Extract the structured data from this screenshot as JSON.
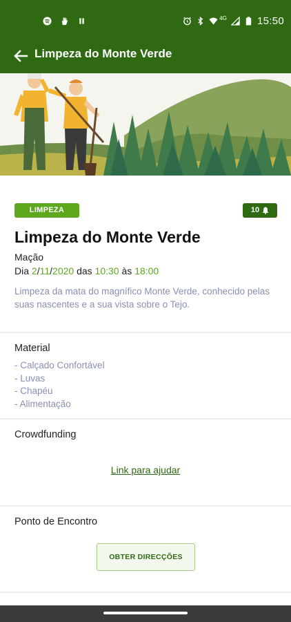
{
  "status_bar": {
    "time": "15:50",
    "network": "4G",
    "left_icons": [
      "spotify-icon",
      "hand-icon",
      "pause-icon"
    ],
    "right_icons": [
      "alarm-icon",
      "bluetooth-icon",
      "wifi-icon",
      "signal-icon",
      "battery-icon"
    ]
  },
  "app_bar": {
    "title": "Limpeza do Monte Verde",
    "back_icon": "arrow-left-icon"
  },
  "event": {
    "category": "LIMPEZA",
    "participants": "10",
    "title": "Limpeza do Monte Verde",
    "place": "Mação",
    "date_prefix": "Dia ",
    "day": "2",
    "slash1": "/",
    "month": "11",
    "slash2": "/",
    "year": "2020",
    "time_prefix": " das ",
    "start_time": "10:30",
    "time_mid": " às ",
    "end_time": "18:00",
    "description": "Limpeza da mata do magnífico Monte Verde, conhecido pelas suas nascentes e a sua vista sobre o Tejo."
  },
  "material": {
    "title": "Material",
    "items": [
      "- Calçado Confortável",
      "- Luvas",
      "- Chapéu",
      "- Alimentação"
    ]
  },
  "crowdfunding": {
    "title": "Crowdfunding",
    "link_label": "Link para ajudar"
  },
  "meeting_point": {
    "title": "Ponto de Encontro",
    "button_label": "OBTER DIRECÇÕES"
  },
  "colors": {
    "primary": "#2f6a12",
    "accent": "#5ea81f",
    "description_text": "#8a8fb0"
  }
}
